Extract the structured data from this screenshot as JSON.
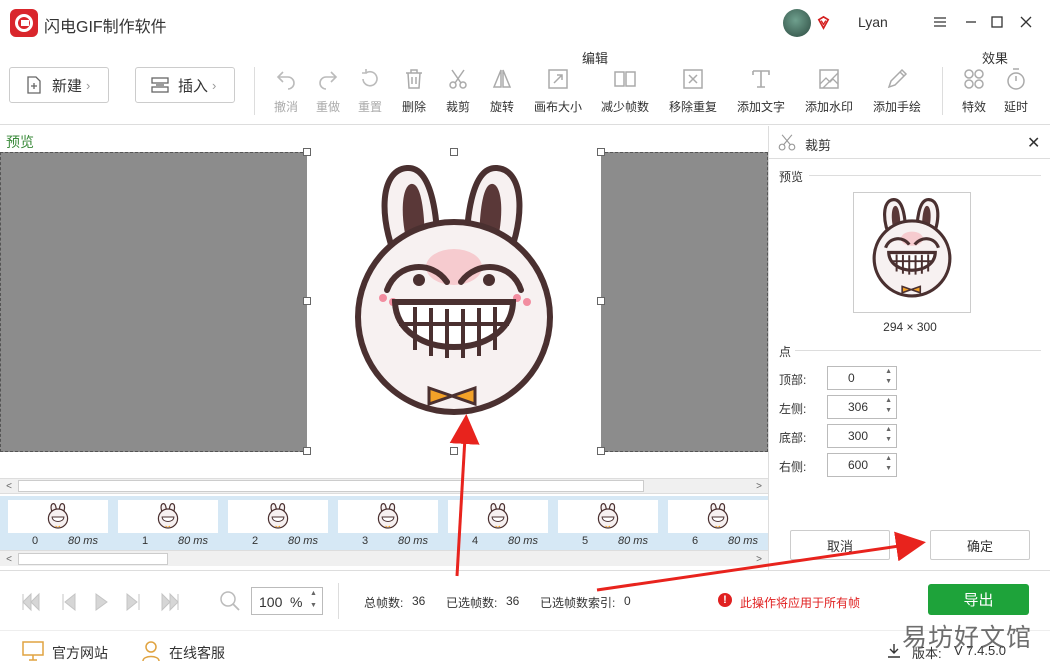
{
  "app": {
    "title": "闪电GIF制作软件",
    "user": "Lyan"
  },
  "toolbar": {
    "new_label": "新建",
    "insert_label": "插入",
    "edit_group": "编辑",
    "effects_group": "效果",
    "tools": [
      {
        "label": "撤消",
        "icon": "undo-icon",
        "enabled": false
      },
      {
        "label": "重做",
        "icon": "redo-icon",
        "enabled": false
      },
      {
        "label": "重置",
        "icon": "reset-icon",
        "enabled": false
      },
      {
        "label": "删除",
        "icon": "trash-icon",
        "enabled": true
      },
      {
        "label": "裁剪",
        "icon": "scissors-icon",
        "enabled": true
      },
      {
        "label": "旋转",
        "icon": "rotate-icon",
        "enabled": true
      },
      {
        "label": "画布大小",
        "icon": "canvas-resize-icon",
        "enabled": true
      },
      {
        "label": "减少帧数",
        "icon": "reduce-frames-icon",
        "enabled": true
      },
      {
        "label": "移除重复",
        "icon": "remove-duplicate-icon",
        "enabled": true
      },
      {
        "label": "添加文字",
        "icon": "text-icon",
        "enabled": true
      },
      {
        "label": "添加水印",
        "icon": "watermark-icon",
        "enabled": true
      },
      {
        "label": "添加手绘",
        "icon": "pen-icon",
        "enabled": true
      },
      {
        "label": "特效",
        "icon": "effects-icon",
        "enabled": true
      },
      {
        "label": "延时",
        "icon": "timer-icon",
        "enabled": true
      }
    ]
  },
  "preview": {
    "label": "预览"
  },
  "frames": [
    {
      "index": "0",
      "duration": "80 ms"
    },
    {
      "index": "1",
      "duration": "80 ms"
    },
    {
      "index": "2",
      "duration": "80 ms"
    },
    {
      "index": "3",
      "duration": "80 ms"
    },
    {
      "index": "4",
      "duration": "80 ms"
    },
    {
      "index": "5",
      "duration": "80 ms"
    },
    {
      "index": "6",
      "duration": "80 ms"
    }
  ],
  "crop_panel": {
    "title": "裁剪",
    "preview_label": "预览",
    "size": "294 × 300",
    "points_label": "点",
    "fields": [
      {
        "label": "顶部:",
        "value": "0"
      },
      {
        "label": "左侧:",
        "value": "306"
      },
      {
        "label": "底部:",
        "value": "300"
      },
      {
        "label": "右侧:",
        "value": "600"
      }
    ],
    "cancel_label": "取消",
    "confirm_label": "确定"
  },
  "playback": {
    "zoom_value": "100",
    "zoom_unit": "%",
    "total_frames_label": "总帧数:",
    "total_frames": "36",
    "selected_frames_label": "已选帧数:",
    "selected_frames": "36",
    "selected_index_label": "已选帧数索引:",
    "selected_index": "0",
    "warning": "此操作将应用于所有帧",
    "export_label": "导出"
  },
  "status": {
    "website_label": "官方网站",
    "support_label": "在线客服",
    "version_label": "版本:",
    "version_value": "V 7.4.5.0"
  },
  "watermark": "易坊好文馆",
  "colors": {
    "accent_green": "#1ea33a",
    "warning_red": "#e02020",
    "annotation_red": "#e8231d",
    "frame_strip": "#d6e8f5",
    "canvas_gray": "#8c8c8c"
  }
}
